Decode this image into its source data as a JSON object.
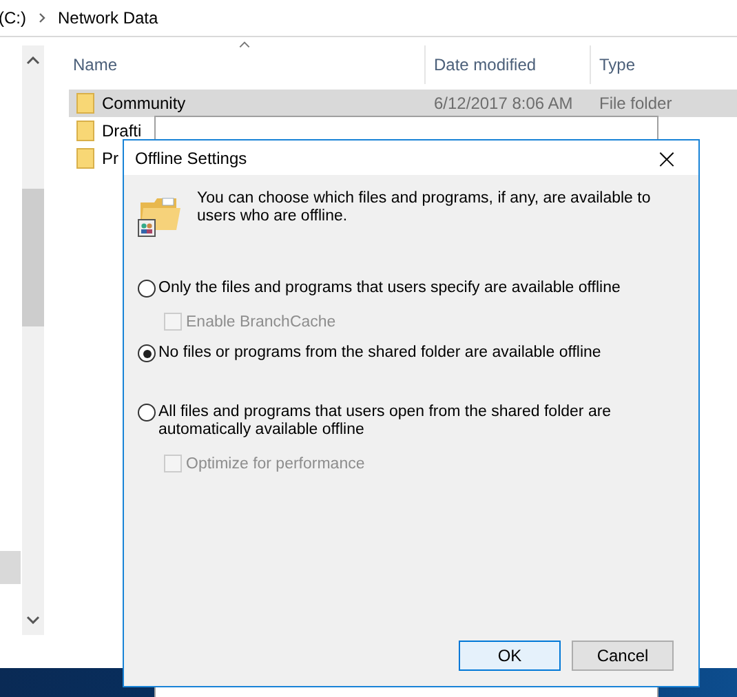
{
  "explorer": {
    "breadcrumb": [
      "(C:)",
      "Network Data"
    ],
    "columns": [
      "Name",
      "Date modified",
      "Type"
    ],
    "rows": [
      {
        "name": "Community",
        "date": "6/12/2017 8:06 AM",
        "type": "File folder",
        "selected": true
      },
      {
        "name": "Drafti",
        "selected": false
      },
      {
        "name": "Pr",
        "selected": false
      }
    ]
  },
  "dialog": {
    "title": "Offline Settings",
    "close": "×",
    "description": "You can choose which files and programs, if any, are available to users who are offline.",
    "options": [
      {
        "label": "Only the files and programs that users specify are available offline",
        "selected": false,
        "sub": {
          "label": "Enable BranchCache",
          "checked": false,
          "disabled": true
        }
      },
      {
        "label": "No files or programs from the shared folder are available offline",
        "selected": true
      },
      {
        "label": "All files and programs that users open from the shared folder are automatically available offline",
        "selected": false,
        "sub": {
          "label": "Optimize for performance",
          "checked": false,
          "disabled": true
        }
      }
    ],
    "buttons": [
      {
        "label": "OK",
        "default": true
      },
      {
        "label": "Cancel",
        "default": false
      }
    ]
  }
}
